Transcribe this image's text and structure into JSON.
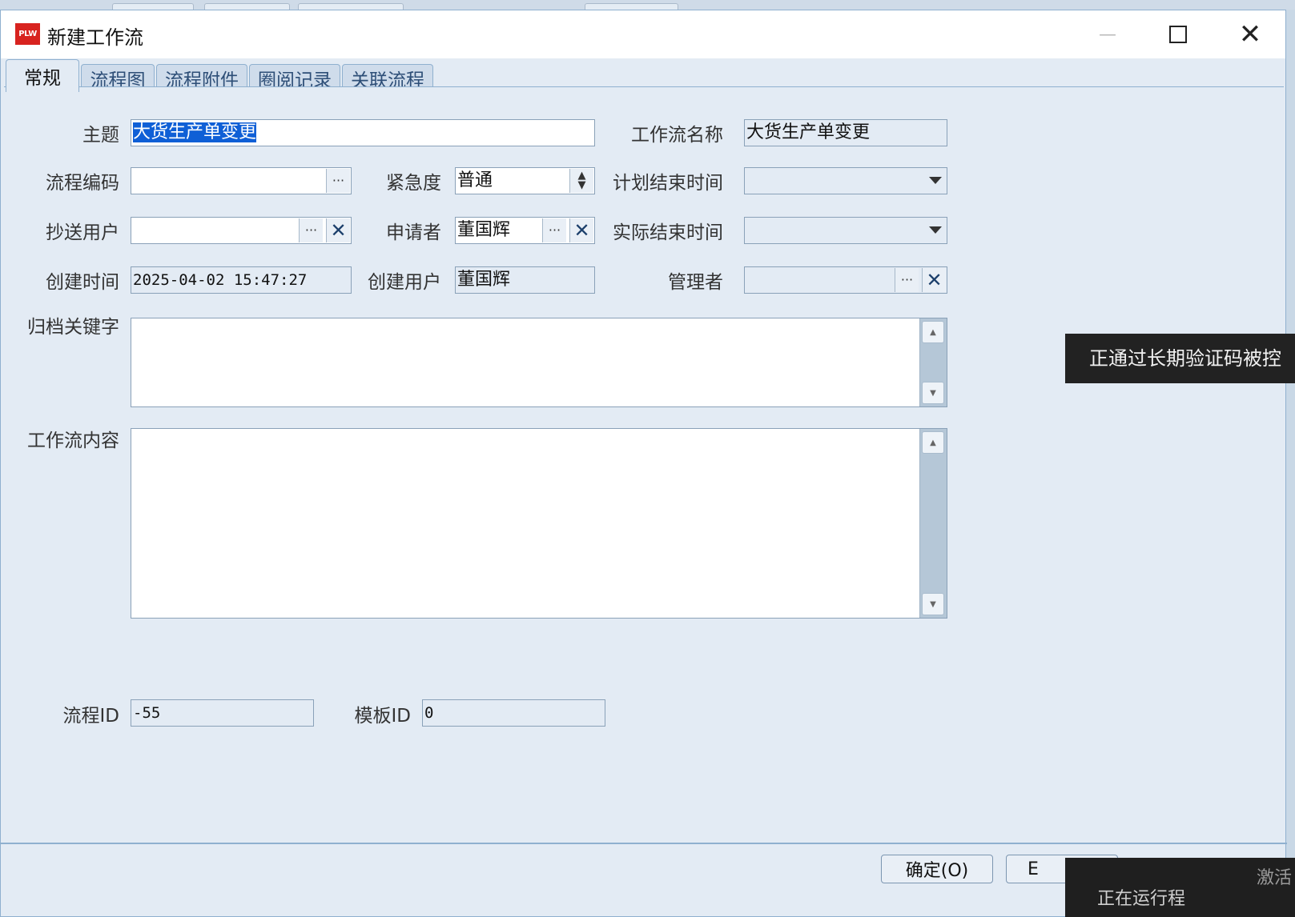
{
  "window": {
    "title": "新建工作流",
    "logo_text": "PLW"
  },
  "tabs": [
    {
      "label": "常规",
      "active": true
    },
    {
      "label": "流程图"
    },
    {
      "label": "流程附件"
    },
    {
      "label": "圈阅记录"
    },
    {
      "label": "关联流程"
    }
  ],
  "form": {
    "subject": {
      "label": "主题",
      "value": "大货生产单变更"
    },
    "workflow_name": {
      "label": "工作流名称",
      "value": "大货生产单变更"
    },
    "process_code": {
      "label": "流程编码",
      "value": ""
    },
    "urgency": {
      "label": "紧急度",
      "value": "普通"
    },
    "planned_end": {
      "label": "计划结束时间",
      "value": ""
    },
    "cc_users": {
      "label": "抄送用户",
      "value": ""
    },
    "applicant": {
      "label": "申请者",
      "value": "董国辉"
    },
    "actual_end": {
      "label": "实际结束时间",
      "value": ""
    },
    "created_time": {
      "label": "创建时间",
      "value": "2025-04-02 15:47:27"
    },
    "created_user": {
      "label": "创建用户",
      "value": "董国辉"
    },
    "manager": {
      "label": "管理者",
      "value": ""
    },
    "archive_keywords": {
      "label": "归档关键字",
      "value": ""
    },
    "content": {
      "label": "工作流内容",
      "value": ""
    },
    "process_id": {
      "label": "流程ID",
      "value": "-55"
    },
    "template_id": {
      "label": "模板ID",
      "value": "0"
    }
  },
  "buttons": {
    "browse": "···",
    "clear": "✕",
    "ok": "确定(O)",
    "second_partial": "E"
  },
  "notifications": {
    "toast_top": "正通过长期验证码被控",
    "toast_bottom": "正在运行程",
    "toast_bottom_faint": "激活"
  },
  "colors": {
    "selection": "#0f5fd6",
    "panel": "#e3ebf4",
    "border": "#8fb0cf",
    "logo": "#d8231f"
  }
}
